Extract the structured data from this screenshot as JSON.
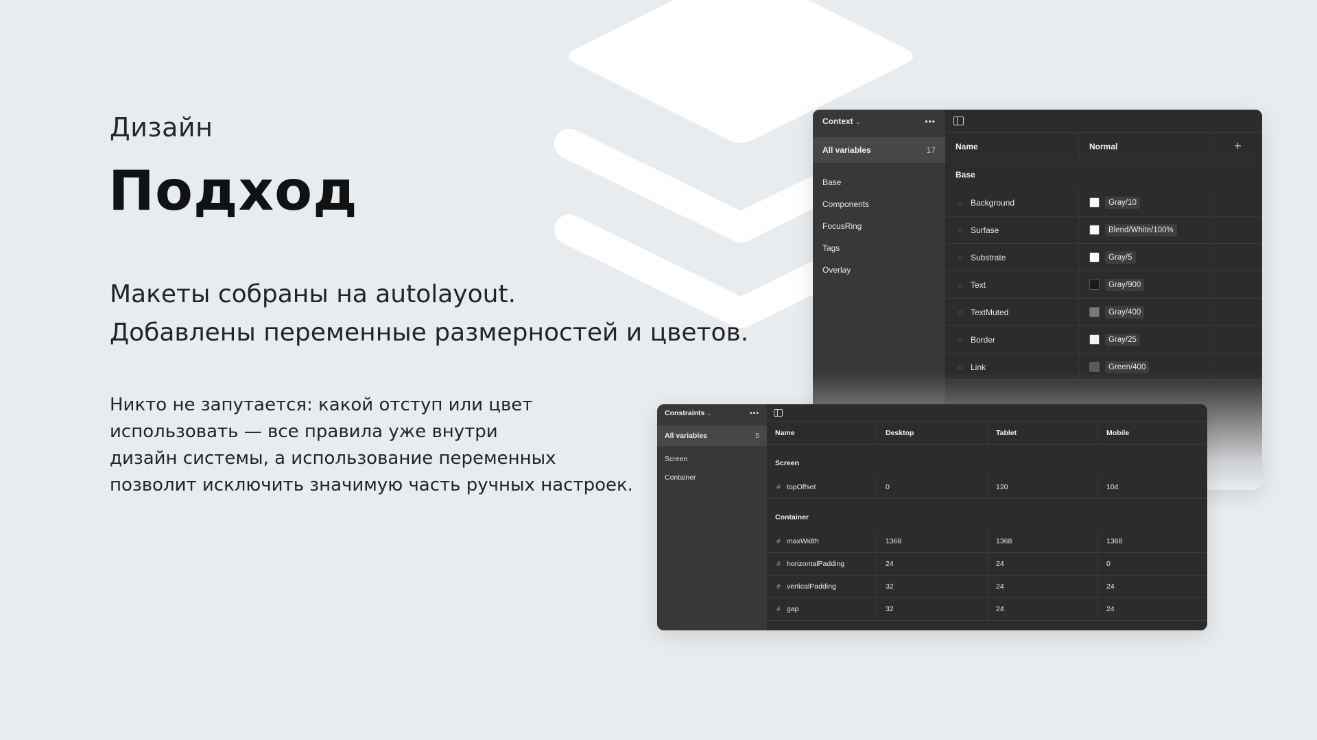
{
  "slide": {
    "eyebrow": "Дизайн",
    "headline": "Подход",
    "lead_lines": [
      "Макеты собраны на autolayout.",
      "Добавлены переменные размерностей и цветов."
    ],
    "body_lines": [
      "Никто не запутается: какой отступ или цвет",
      "использовать — все правила уже внутри",
      "дизайн системы, а использование переменных",
      "позволит исключить значимую часть ручных настроек."
    ]
  },
  "colors_panel": {
    "collection": "Context",
    "menu_icon": "more-dots-icon",
    "all_label": "All variables",
    "all_count": "17",
    "groups": [
      "Base",
      "Components",
      "FocusRing",
      "Tags",
      "Overlay"
    ],
    "col_name": "Name",
    "col_mode": "Normal",
    "add_label": "+",
    "group_title": "Base",
    "rows": [
      {
        "name": "Background",
        "value": "Gray/10",
        "swatch": "#ffffff"
      },
      {
        "name": "Surfase",
        "value": "Blend/White/100%",
        "swatch": "#ffffff"
      },
      {
        "name": "Substrate",
        "value": "Gray/5",
        "swatch": "#ffffff"
      },
      {
        "name": "Text",
        "value": "Gray/900",
        "swatch": "#1a1a1a"
      },
      {
        "name": "TextMuted",
        "value": "Gray/400",
        "swatch": "#7a7a7a"
      },
      {
        "name": "Border",
        "value": "Gray/25",
        "swatch": "#f2f2f2"
      },
      {
        "name": "Link",
        "value": "Green/400",
        "swatch": "#5a5a5a"
      }
    ]
  },
  "sizes_panel": {
    "collection": "Constraints",
    "all_label": "All variables",
    "all_count": "5",
    "groups": [
      "Screen",
      "Container"
    ],
    "columns": [
      "Name",
      "Desktop",
      "Tablet",
      "Mobile"
    ],
    "sections": [
      {
        "title": "Screen",
        "rows": [
          {
            "name": "topOffset",
            "values": [
              "0",
              "120",
              "104"
            ]
          }
        ]
      },
      {
        "title": "Container",
        "rows": [
          {
            "name": "maxWidth",
            "values": [
              "1368",
              "1368",
              "1368"
            ]
          },
          {
            "name": "horizontalPadding",
            "values": [
              "24",
              "24",
              "0"
            ]
          },
          {
            "name": "verticalPadding",
            "values": [
              "32",
              "24",
              "24"
            ]
          },
          {
            "name": "gap",
            "values": [
              "32",
              "24",
              "24"
            ]
          }
        ]
      }
    ]
  }
}
